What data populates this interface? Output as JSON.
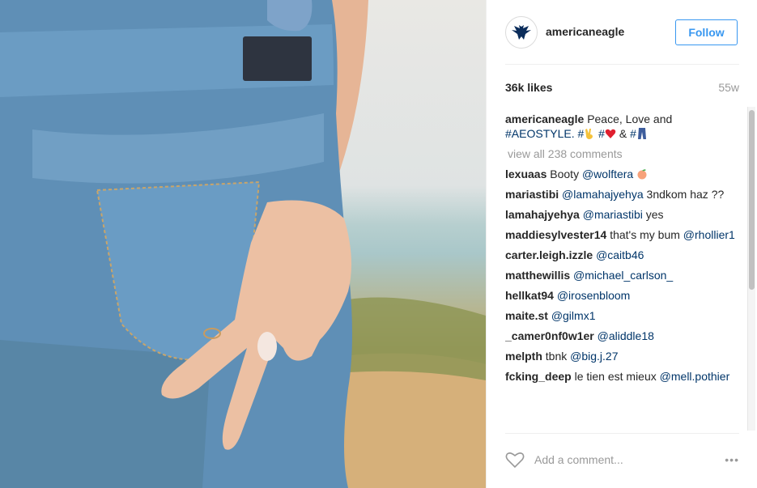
{
  "post": {
    "username": "americaneagle",
    "follow_label": "Follow",
    "likes": "36k likes",
    "age": "55w",
    "caption": {
      "user": "americaneagle",
      "text": "Peace, Love and",
      "hashtag": "#AEOSTYLE.",
      "tail1": "#",
      "tail2": "#",
      "amp": "&",
      "tail3": "#"
    },
    "view_all": "view all 238 comments",
    "comments": [
      {
        "user": "lexuaas",
        "text": "Booty",
        "mention": "@wolftera",
        "emoji": "peach-emoji"
      },
      {
        "user": "mariastibi",
        "mention": "@lamahajyehya",
        "text": "3ndkom haz ??"
      },
      {
        "user": "lamahajyehya",
        "mention": "@mariastibi",
        "text": "yes"
      },
      {
        "user": "maddiesylvester14",
        "text": "that's my bum",
        "mention": "@rhollier1"
      },
      {
        "user": "carter.leigh.izzle",
        "mention": "@caitb46"
      },
      {
        "user": "matthewillis",
        "mention": "@michael_carlson_"
      },
      {
        "user": "hellkat94",
        "mention": "@irosenbloom"
      },
      {
        "user": "maite.st",
        "mention": "@gilmx1"
      },
      {
        "user": "_camer0nf0w1er",
        "mention": "@aliddle18"
      },
      {
        "user": "melpth",
        "text": "tbnk",
        "mention": "@big.j.27"
      },
      {
        "user": "fcking_deep",
        "text": "le tien est mieux",
        "mention": "@mell.pothier"
      }
    ],
    "add_comment_placeholder": "Add a comment...",
    "more_label": "•••"
  },
  "colors": {
    "link": "#003569",
    "follow": "#3897f0",
    "muted": "#999999",
    "text": "#262626"
  },
  "icons": [
    "eagle-logo-icon",
    "heart-icon",
    "more-options-icon",
    "victory-hand-emoji",
    "red-heart-emoji",
    "jeans-emoji",
    "peach-emoji"
  ]
}
